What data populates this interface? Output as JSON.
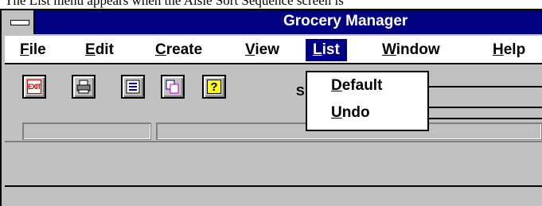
{
  "caption": "The List menu appears when the Aisle Sort Sequence screen is",
  "window": {
    "title": "Grocery Manager"
  },
  "menubar": {
    "items": [
      {
        "label": "File",
        "mnemonic": "F",
        "rest": "ile"
      },
      {
        "label": "Edit",
        "mnemonic": "E",
        "rest": "dit"
      },
      {
        "label": "Create",
        "mnemonic": "C",
        "rest": "reate"
      },
      {
        "label": "View",
        "mnemonic": "V",
        "rest": "iew"
      },
      {
        "label": "List",
        "mnemonic": "L",
        "rest": "ist"
      },
      {
        "label": "Window",
        "mnemonic": "W",
        "rest": "indow"
      },
      {
        "label": "Help",
        "mnemonic": "H",
        "rest": "elp"
      }
    ],
    "active": "List"
  },
  "toolbar": {
    "buttons": [
      {
        "icon": "exit-icon",
        "label": "EXIT",
        "color": "#cc0000"
      },
      {
        "icon": "printer-icon"
      },
      {
        "icon": "list-icon"
      },
      {
        "icon": "copy-icon"
      },
      {
        "icon": "help-icon",
        "label": "?"
      }
    ]
  },
  "partial_text": "S",
  "list_menu": {
    "items": [
      {
        "label": "Default",
        "mnemonic": "D",
        "rest": "efault"
      },
      {
        "label": "Undo",
        "mnemonic": "U",
        "rest": "ndo"
      }
    ]
  },
  "colors": {
    "titlebar": "#000080",
    "menu_highlight": "#000080",
    "chrome": "#c0c0c0"
  }
}
